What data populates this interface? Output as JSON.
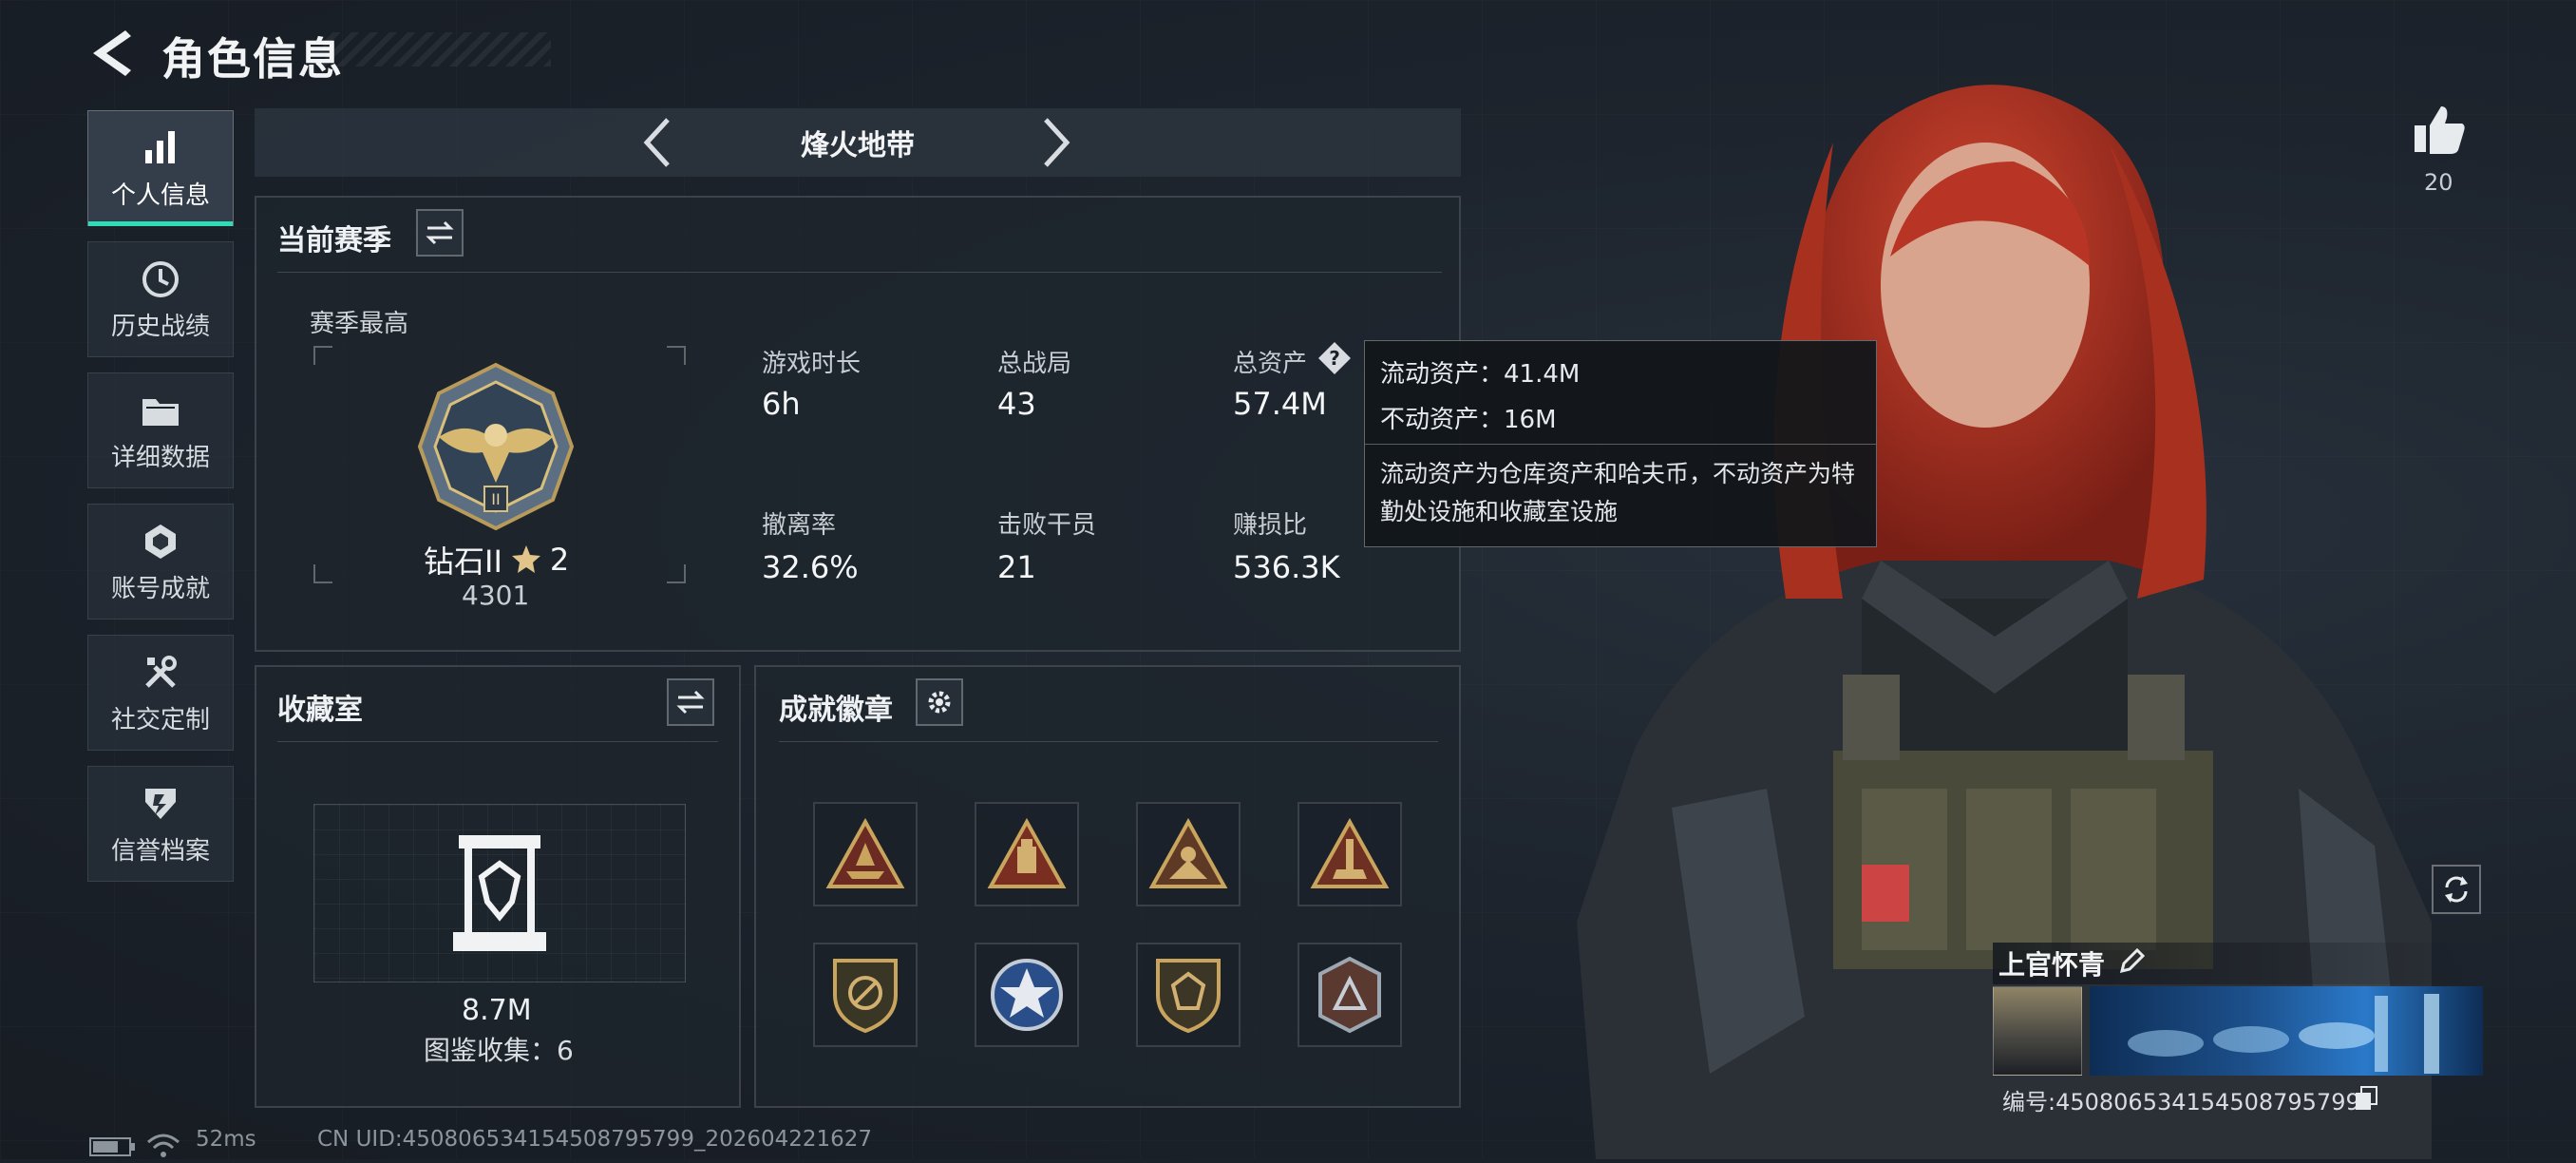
{
  "header": {
    "title": "角色信息"
  },
  "sidebar": {
    "items": [
      {
        "label": "个人信息",
        "icon": "bar-chart-icon",
        "active": true
      },
      {
        "label": "历史战绩",
        "icon": "clock-history-icon"
      },
      {
        "label": "详细数据",
        "icon": "folder-icon"
      },
      {
        "label": "账号成就",
        "icon": "badge-icon"
      },
      {
        "label": "社交定制",
        "icon": "tools-icon"
      },
      {
        "label": "信誉档案",
        "icon": "shield-icon"
      }
    ]
  },
  "mode": {
    "title": "烽火地带"
  },
  "season": {
    "title": "当前赛季",
    "subtitle": "赛季最高",
    "rank_name": "钻石II",
    "rank_stars": "2",
    "rank_score": "4301",
    "stats": [
      {
        "label": "游戏时长",
        "value": "6h"
      },
      {
        "label": "总战局",
        "value": "43"
      },
      {
        "label": "总资产",
        "value": "57.4M"
      },
      {
        "label": "撤离率",
        "value": "32.6%"
      },
      {
        "label": "击败干员",
        "value": "21"
      },
      {
        "label": "赚损比",
        "value": "536.3K"
      }
    ]
  },
  "tooltip": {
    "line1": "流动资产：41.4M",
    "line2": "不动资产：16M",
    "description": "流动资产为仓库资产和哈夫币，不动资产为特勤处设施和收藏室设施"
  },
  "collection": {
    "title": "收藏室",
    "value": "8.7M",
    "catalog": "图鉴收集：6"
  },
  "achievements": {
    "title": "成就徽章"
  },
  "profile": {
    "likes": "20",
    "name": "上官怀青",
    "id_text": "编号:450806534154508795799"
  },
  "footer": {
    "ping": "52ms",
    "uid": "CN UID:450806534154508795799_202604221627"
  },
  "colors": {
    "accent": "#2fdcb8",
    "hair": "#c0392b"
  }
}
